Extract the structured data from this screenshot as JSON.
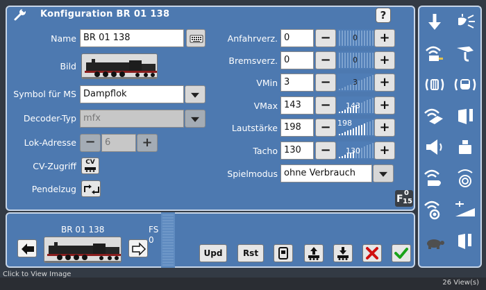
{
  "title": "Konfiguration BR 01 138",
  "help_label": "?",
  "left_form": {
    "name_label": "Name",
    "name_value": "BR 01 138",
    "bild_label": "Bild",
    "symbol_label": "Symbol für MS",
    "symbol_value": "Dampflok",
    "decoder_label": "Decoder-Typ",
    "decoder_value": "mfx",
    "address_label": "Lok-Adresse",
    "address_value": "6",
    "cv_label": "CV-Zugriff",
    "cv_button_label": "CV",
    "pendel_label": "Pendelzug"
  },
  "right_form": {
    "rows": [
      {
        "label": "Anfahrverz.",
        "value": "0",
        "slider_value": "0",
        "fill": 0
      },
      {
        "label": "Bremsverz.",
        "value": "0",
        "slider_value": "0",
        "fill": 0
      },
      {
        "label": "VMin",
        "value": "3",
        "slider_value": "3",
        "fill": 0.02
      },
      {
        "label": "VMax",
        "value": "143",
        "slider_value": "143",
        "fill": 0.56
      },
      {
        "label": "Lautstärke",
        "value": "198",
        "slider_value": "198",
        "fill": 0.78
      },
      {
        "label": "Tacho",
        "value": "130",
        "slider_value": "130",
        "fill": 0.51
      }
    ],
    "spielmodus_label": "Spielmodus",
    "spielmodus_value": "ohne Verbrauch",
    "minus_label": "−",
    "plus_label": "+"
  },
  "f15": {
    "letter": "F",
    "top": "0",
    "bottom": "15"
  },
  "bottom": {
    "loco_name": "BR 01 138",
    "fs_label": "FS",
    "fs_value": "0",
    "upd_label": "Upd",
    "rst_label": "Rst"
  },
  "status": {
    "left": "Click to View Image",
    "right": "26 View(s)"
  },
  "side_icons": [
    "arrow-down-icon",
    "headlight-icon",
    "signal-device-icon",
    "crane-hook-icon",
    "cab-sound-icon",
    "car-sound-icon",
    "wireless-couple-icon",
    "horn-icon",
    "loudspeaker-icon",
    "weight-icon",
    "whistle-wireless-icon",
    "wheel-signal-icon",
    "wheel-wireless-icon",
    "ramp-icon",
    "turtle-icon",
    "door-horn-icon"
  ]
}
